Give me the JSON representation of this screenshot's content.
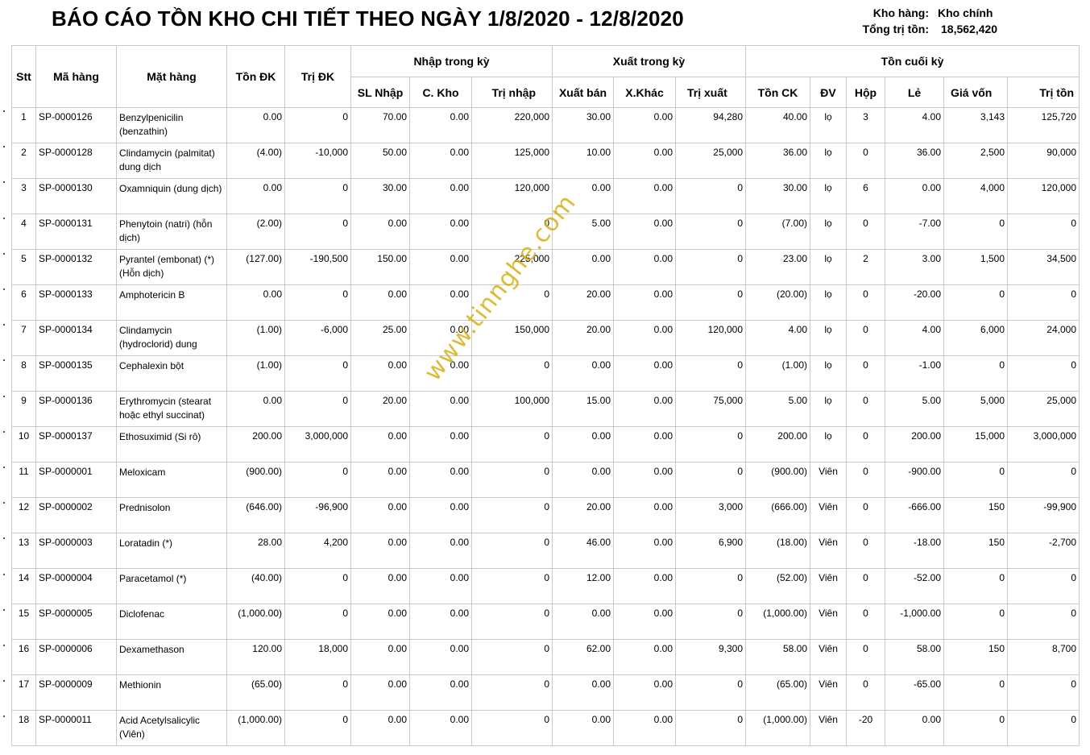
{
  "report": {
    "title": "BÁO CÁO TỒN KHO CHI TIẾT THEO NGÀY 1/8/2020 - 12/8/2020",
    "warehouse_label": "Kho hàng:",
    "warehouse_value": "Kho chính",
    "total_label": "Tổng trị tồn:",
    "total_value": "18,562,420"
  },
  "watermark": "www.tinnghe.com",
  "table": {
    "headers": {
      "stt": "Stt",
      "code": "Mã hàng",
      "name": "Mặt hàng",
      "open_qty": "Tồn ĐK",
      "open_val": "Trị ĐK",
      "group_in": "Nhập trong kỳ",
      "group_out": "Xuất trong kỳ",
      "group_end": "Tồn cuối kỳ",
      "in_qty": "SL Nhập",
      "in_transfer": "C. Kho",
      "in_val": "Trị nhập",
      "out_sale": "Xuất bán",
      "out_other": "X.Khác",
      "out_val": "Trị xuất",
      "end_qty": "Tồn CK",
      "unit": "ĐV",
      "box": "Hộp",
      "loose": "Lẻ",
      "cost": "Giá vốn",
      "end_val": "Trị tồn"
    },
    "rows": [
      {
        "stt": "1",
        "code": "SP-0000126",
        "name": "Benzylpenicilin (benzathin)",
        "open_qty": "0.00",
        "open_val": "0",
        "in_qty": "70.00",
        "in_transfer": "0.00",
        "in_val": "220,000",
        "out_sale": "30.00",
        "out_other": "0.00",
        "out_val": "94,280",
        "end_qty": "40.00",
        "unit": "lọ",
        "box": "3",
        "loose": "4.00",
        "cost": "3,143",
        "end_val": "125,720"
      },
      {
        "stt": "2",
        "code": "SP-0000128",
        "name": "Clindamycin (palmitat) dung dịch",
        "open_qty": "(4.00)",
        "open_val": "-10,000",
        "in_qty": "50.00",
        "in_transfer": "0.00",
        "in_val": "125,000",
        "out_sale": "10.00",
        "out_other": "0.00",
        "out_val": "25,000",
        "end_qty": "36.00",
        "unit": "lọ",
        "box": "0",
        "loose": "36.00",
        "cost": "2,500",
        "end_val": "90,000"
      },
      {
        "stt": "3",
        "code": "SP-0000130",
        "name": "Oxamniquin (dung dịch)",
        "open_qty": "0.00",
        "open_val": "0",
        "in_qty": "30.00",
        "in_transfer": "0.00",
        "in_val": "120,000",
        "out_sale": "0.00",
        "out_other": "0.00",
        "out_val": "0",
        "end_qty": "30.00",
        "unit": "lọ",
        "box": "6",
        "loose": "0.00",
        "cost": "4,000",
        "end_val": "120,000"
      },
      {
        "stt": "4",
        "code": "SP-0000131",
        "name": "Phenytoin (natri) (hỗn dịch)",
        "open_qty": "(2.00)",
        "open_val": "0",
        "in_qty": "0.00",
        "in_transfer": "0.00",
        "in_val": "0",
        "out_sale": "5.00",
        "out_other": "0.00",
        "out_val": "0",
        "end_qty": "(7.00)",
        "unit": "lọ",
        "box": "0",
        "loose": "-7.00",
        "cost": "0",
        "end_val": "0"
      },
      {
        "stt": "5",
        "code": "SP-0000132",
        "name": "Pyrantel (embonat) (*) (Hỗn dịch)",
        "open_qty": "(127.00)",
        "open_val": "-190,500",
        "in_qty": "150.00",
        "in_transfer": "0.00",
        "in_val": "225,000",
        "out_sale": "0.00",
        "out_other": "0.00",
        "out_val": "0",
        "end_qty": "23.00",
        "unit": "lọ",
        "box": "2",
        "loose": "3.00",
        "cost": "1,500",
        "end_val": "34,500"
      },
      {
        "stt": "6",
        "code": "SP-0000133",
        "name": "Amphotericin B",
        "open_qty": "0.00",
        "open_val": "0",
        "in_qty": "0.00",
        "in_transfer": "0.00",
        "in_val": "0",
        "out_sale": "20.00",
        "out_other": "0.00",
        "out_val": "0",
        "end_qty": "(20.00)",
        "unit": "lọ",
        "box": "0",
        "loose": "-20.00",
        "cost": "0",
        "end_val": "0"
      },
      {
        "stt": "7",
        "code": "SP-0000134",
        "name": "Clindamycin (hydroclorid) dung",
        "open_qty": "(1.00)",
        "open_val": "-6,000",
        "in_qty": "25.00",
        "in_transfer": "0.00",
        "in_val": "150,000",
        "out_sale": "20.00",
        "out_other": "0.00",
        "out_val": "120,000",
        "end_qty": "4.00",
        "unit": "lọ",
        "box": "0",
        "loose": "4.00",
        "cost": "6,000",
        "end_val": "24,000"
      },
      {
        "stt": "8",
        "code": "SP-0000135",
        "name": "Cephalexin bột",
        "open_qty": "(1.00)",
        "open_val": "0",
        "in_qty": "0.00",
        "in_transfer": "0.00",
        "in_val": "0",
        "out_sale": "0.00",
        "out_other": "0.00",
        "out_val": "0",
        "end_qty": "(1.00)",
        "unit": "lọ",
        "box": "0",
        "loose": "-1.00",
        "cost": "0",
        "end_val": "0"
      },
      {
        "stt": "9",
        "code": "SP-0000136",
        "name": "Erythromycin (stearat hoặc ethyl succinat)",
        "open_qty": "0.00",
        "open_val": "0",
        "in_qty": "20.00",
        "in_transfer": "0.00",
        "in_val": "100,000",
        "out_sale": "15.00",
        "out_other": "0.00",
        "out_val": "75,000",
        "end_qty": "5.00",
        "unit": "lọ",
        "box": "0",
        "loose": "5.00",
        "cost": "5,000",
        "end_val": "25,000"
      },
      {
        "stt": "10",
        "code": "SP-0000137",
        "name": "Ethosuximid (Si rô)",
        "open_qty": "200.00",
        "open_val": "3,000,000",
        "in_qty": "0.00",
        "in_transfer": "0.00",
        "in_val": "0",
        "out_sale": "0.00",
        "out_other": "0.00",
        "out_val": "0",
        "end_qty": "200.00",
        "unit": "lọ",
        "box": "0",
        "loose": "200.00",
        "cost": "15,000",
        "end_val": "3,000,000"
      },
      {
        "stt": "11",
        "code": "SP-0000001",
        "name": "Meloxicam",
        "open_qty": "(900.00)",
        "open_val": "0",
        "in_qty": "0.00",
        "in_transfer": "0.00",
        "in_val": "0",
        "out_sale": "0.00",
        "out_other": "0.00",
        "out_val": "0",
        "end_qty": "(900.00)",
        "unit": "Viên",
        "box": "0",
        "loose": "-900.00",
        "cost": "0",
        "end_val": "0"
      },
      {
        "stt": "12",
        "code": "SP-0000002",
        "name": "Prednisolon",
        "open_qty": "(646.00)",
        "open_val": "-96,900",
        "in_qty": "0.00",
        "in_transfer": "0.00",
        "in_val": "0",
        "out_sale": "20.00",
        "out_other": "0.00",
        "out_val": "3,000",
        "end_qty": "(666.00)",
        "unit": "Viên",
        "box": "0",
        "loose": "-666.00",
        "cost": "150",
        "end_val": "-99,900"
      },
      {
        "stt": "13",
        "code": "SP-0000003",
        "name": "Loratadin (*)",
        "open_qty": "28.00",
        "open_val": "4,200",
        "in_qty": "0.00",
        "in_transfer": "0.00",
        "in_val": "0",
        "out_sale": "46.00",
        "out_other": "0.00",
        "out_val": "6,900",
        "end_qty": "(18.00)",
        "unit": "Viên",
        "box": "0",
        "loose": "-18.00",
        "cost": "150",
        "end_val": "-2,700"
      },
      {
        "stt": "14",
        "code": "SP-0000004",
        "name": "Paracetamol (*)",
        "open_qty": "(40.00)",
        "open_val": "0",
        "in_qty": "0.00",
        "in_transfer": "0.00",
        "in_val": "0",
        "out_sale": "12.00",
        "out_other": "0.00",
        "out_val": "0",
        "end_qty": "(52.00)",
        "unit": "Viên",
        "box": "0",
        "loose": "-52.00",
        "cost": "0",
        "end_val": "0"
      },
      {
        "stt": "15",
        "code": "SP-0000005",
        "name": "Diclofenac",
        "open_qty": "(1,000.00)",
        "open_val": "0",
        "in_qty": "0.00",
        "in_transfer": "0.00",
        "in_val": "0",
        "out_sale": "0.00",
        "out_other": "0.00",
        "out_val": "0",
        "end_qty": "(1,000.00)",
        "unit": "Viên",
        "box": "0",
        "loose": "-1,000.00",
        "cost": "0",
        "end_val": "0"
      },
      {
        "stt": "16",
        "code": "SP-0000006",
        "name": "Dexamethason",
        "open_qty": "120.00",
        "open_val": "18,000",
        "in_qty": "0.00",
        "in_transfer": "0.00",
        "in_val": "0",
        "out_sale": "62.00",
        "out_other": "0.00",
        "out_val": "9,300",
        "end_qty": "58.00",
        "unit": "Viên",
        "box": "0",
        "loose": "58.00",
        "cost": "150",
        "end_val": "8,700"
      },
      {
        "stt": "17",
        "code": "SP-0000009",
        "name": "Methionin",
        "open_qty": "(65.00)",
        "open_val": "0",
        "in_qty": "0.00",
        "in_transfer": "0.00",
        "in_val": "0",
        "out_sale": "0.00",
        "out_other": "0.00",
        "out_val": "0",
        "end_qty": "(65.00)",
        "unit": "Viên",
        "box": "0",
        "loose": "-65.00",
        "cost": "0",
        "end_val": "0"
      },
      {
        "stt": "18",
        "code": "SP-0000011",
        "name": "Acid Acetylsalicylic (Viên)",
        "open_qty": "(1,000.00)",
        "open_val": "0",
        "in_qty": "0.00",
        "in_transfer": "0.00",
        "in_val": "0",
        "out_sale": "0.00",
        "out_other": "0.00",
        "out_val": "0",
        "end_qty": "(1,000.00)",
        "unit": "Viên",
        "box": "-20",
        "loose": "0.00",
        "cost": "0",
        "end_val": "0"
      }
    ]
  }
}
